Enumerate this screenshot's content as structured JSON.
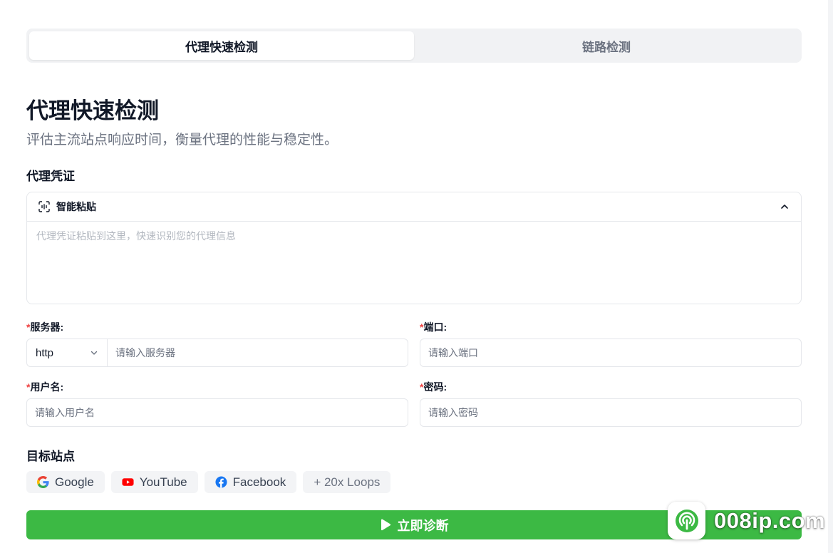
{
  "tabs": [
    {
      "label": "代理快速检测",
      "active": true
    },
    {
      "label": "链路检测",
      "active": false
    }
  ],
  "page": {
    "title": "代理快速检测",
    "subtitle": "评估主流站点响应时间，衡量代理的性能与稳定性。"
  },
  "credentials": {
    "section_label": "代理凭证",
    "smart_paste_label": "智能粘贴",
    "paste_placeholder": "代理凭证粘贴到这里，快速识别您的代理信息"
  },
  "form": {
    "required_mark": "*",
    "server_label": "服务器:",
    "protocol_value": "http",
    "server_placeholder": "请输入服务器",
    "port_label": "端口:",
    "port_placeholder": "请输入端口",
    "username_label": "用户名:",
    "username_placeholder": "请输入用户名",
    "password_label": "密码:",
    "password_placeholder": "请输入密码"
  },
  "targets": {
    "section_label": "目标站点",
    "sites": [
      {
        "label": "Google",
        "icon": "google-icon"
      },
      {
        "label": "YouTube",
        "icon": "youtube-icon"
      },
      {
        "label": "Facebook",
        "icon": "facebook-icon"
      }
    ],
    "more_label": "+ 20x Loops"
  },
  "run_button": {
    "label": "立即诊断",
    "icon": "play-icon"
  },
  "watermark": {
    "text": "008ip.com"
  },
  "colors": {
    "accent_green": "#3cb944",
    "required_red": "#ef4444",
    "youtube_red": "#ff0000",
    "facebook_blue": "#1877f2"
  }
}
